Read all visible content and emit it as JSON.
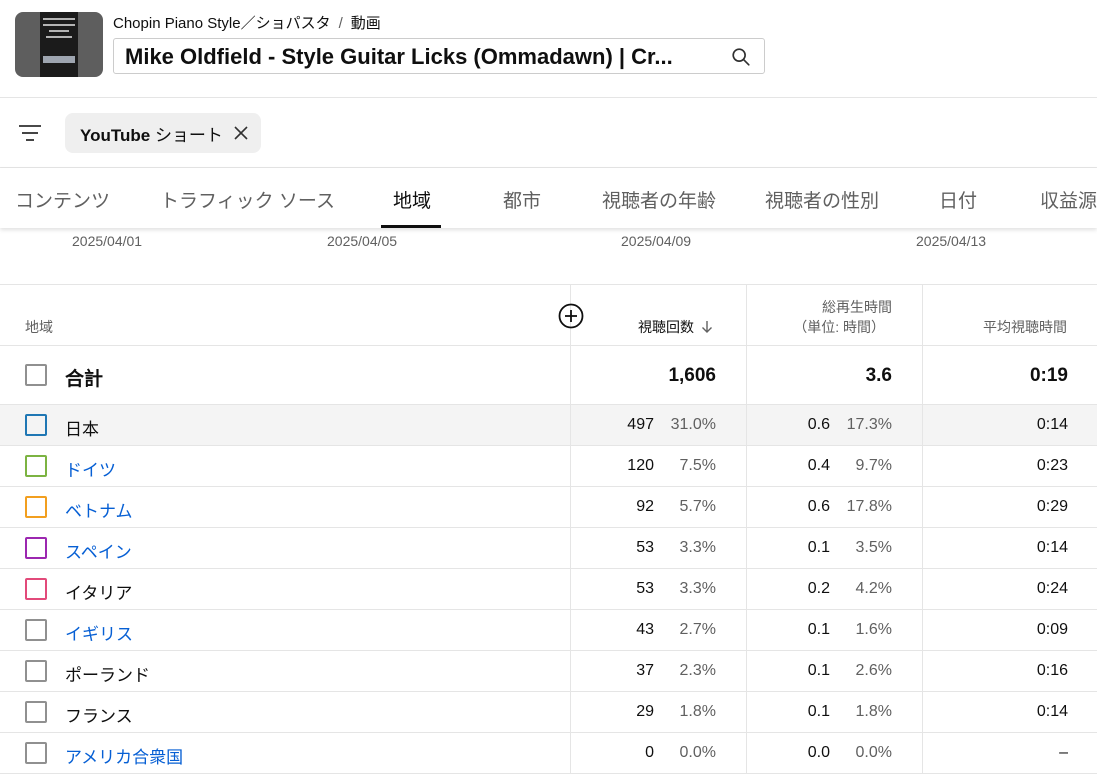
{
  "header": {
    "channel": "Chopin Piano Style／ショパスタ",
    "breadcrumb_sep": "/",
    "section": "動画",
    "video_title": "Mike Oldfield - Style Guitar Licks (Ommadawn) | Cr..."
  },
  "filter": {
    "chip_bold": "YouTube",
    "chip_rest": "ショート"
  },
  "tabs": [
    {
      "label": "コンテンツ"
    },
    {
      "label": "トラフィック ソース"
    },
    {
      "label": "地域"
    },
    {
      "label": "都市"
    },
    {
      "label": "視聴者の年齢"
    },
    {
      "label": "視聴者の性別"
    },
    {
      "label": "日付"
    },
    {
      "label": "収益源"
    }
  ],
  "dates": [
    "2025/04/01",
    "2025/04/05",
    "2025/04/09",
    "2025/04/13"
  ],
  "table": {
    "col_region": "地域",
    "col_views": "視聴回数",
    "col_watch_line1": "総再生時間",
    "col_watch_line2": "（単位: 時間）",
    "col_avg": "平均視聴時間",
    "total": {
      "label": "合計",
      "views": "1,606",
      "watch": "3.6",
      "avg": "0:19"
    },
    "rows": [
      {
        "name": "日本",
        "views": "497",
        "views_pct": "31.0%",
        "watch": "0.6",
        "watch_pct": "17.3%",
        "avg": "0:14",
        "color": "#1f77b4",
        "link": false
      },
      {
        "name": "ドイツ",
        "views": "120",
        "views_pct": "7.5%",
        "watch": "0.4",
        "watch_pct": "9.7%",
        "avg": "0:23",
        "color": "#7cb342",
        "link": true
      },
      {
        "name": "ベトナム",
        "views": "92",
        "views_pct": "5.7%",
        "watch": "0.6",
        "watch_pct": "17.8%",
        "avg": "0:29",
        "color": "#f29f1f",
        "link": true
      },
      {
        "name": "スペイン",
        "views": "53",
        "views_pct": "3.3%",
        "watch": "0.1",
        "watch_pct": "3.5%",
        "avg": "0:14",
        "color": "#9c27b0",
        "link": true
      },
      {
        "name": "イタリア",
        "views": "53",
        "views_pct": "3.3%",
        "watch": "0.2",
        "watch_pct": "4.2%",
        "avg": "0:24",
        "color": "#e24a7a",
        "link": false
      },
      {
        "name": "イギリス",
        "views": "43",
        "views_pct": "2.7%",
        "watch": "0.1",
        "watch_pct": "1.6%",
        "avg": "0:09",
        "color": "#909090",
        "link": true
      },
      {
        "name": "ポーランド",
        "views": "37",
        "views_pct": "2.3%",
        "watch": "0.1",
        "watch_pct": "2.6%",
        "avg": "0:16",
        "color": "#909090",
        "link": false
      },
      {
        "name": "フランス",
        "views": "29",
        "views_pct": "1.8%",
        "watch": "0.1",
        "watch_pct": "1.8%",
        "avg": "0:14",
        "color": "#909090",
        "link": false
      },
      {
        "name": "アメリカ合衆国",
        "views": "0",
        "views_pct": "0.0%",
        "watch": "0.0",
        "watch_pct": "0.0%",
        "avg": "–",
        "color": "#909090",
        "link": true
      }
    ]
  }
}
